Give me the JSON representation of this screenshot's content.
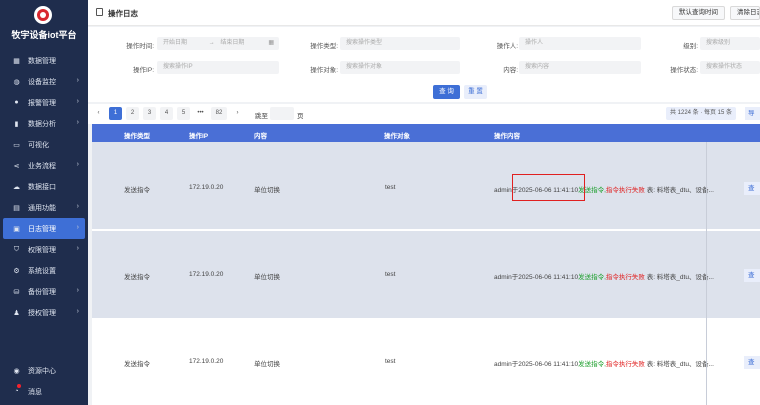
{
  "sidebar": {
    "title": "牧宇设备iot平台",
    "items": [
      {
        "label": "数据管理",
        "icon": "grid-icon",
        "arrow": false
      },
      {
        "label": "设备监控",
        "icon": "globe-icon",
        "arrow": true
      },
      {
        "label": "报警管理",
        "icon": "user-icon",
        "arrow": true
      },
      {
        "label": "数据分析",
        "icon": "bar-chart-icon",
        "arrow": true
      },
      {
        "label": "可视化",
        "icon": "monitor-icon",
        "arrow": false
      },
      {
        "label": "业务流程",
        "icon": "share-icon",
        "arrow": true
      },
      {
        "label": "数据接口",
        "icon": "cloud-icon",
        "arrow": false
      },
      {
        "label": "通用功能",
        "icon": "briefcase-icon",
        "arrow": true
      },
      {
        "label": "日志管理",
        "icon": "log-icon",
        "arrow": true,
        "active": true
      },
      {
        "label": "权限管理",
        "icon": "shield-icon",
        "arrow": true
      },
      {
        "label": "系统设置",
        "icon": "gear-icon",
        "arrow": false
      },
      {
        "label": "备份管理",
        "icon": "database-icon",
        "arrow": true
      },
      {
        "label": "授权管理",
        "icon": "key-user-icon",
        "arrow": true
      }
    ],
    "bottom": [
      {
        "label": "资源中心",
        "icon": "resource-icon"
      },
      {
        "label": "消息",
        "icon": "message-icon"
      }
    ]
  },
  "header": {
    "title": "操作日志",
    "btn_default_time": "默认查询时间",
    "btn_clear_log": "清除日志"
  },
  "filter": {
    "op_time_label": "操作时间:",
    "start_placeholder": "开始日期",
    "range_sep": "→",
    "end_placeholder": "结束日期",
    "op_type_label": "操作类型:",
    "op_type_placeholder": "搜索操作类型",
    "operator_label": "操作人:",
    "operator_placeholder": "操作人",
    "level_label": "级别:",
    "level_placeholder": "搜索级别",
    "ip_label": "操作IP:",
    "ip_placeholder": "搜索操作IP",
    "target_label": "操作对象:",
    "target_placeholder": "搜索操作对象",
    "content_label": "内容:",
    "content_placeholder": "搜索内容",
    "status_label": "操作状态:",
    "status_placeholder": "搜索操作状态",
    "query": "查 询",
    "reset": "重 置"
  },
  "pager": {
    "prev": "‹",
    "pages": [
      "1",
      "2",
      "3",
      "4",
      "5"
    ],
    "ellipsis": "•••",
    "last": "82",
    "next": "›",
    "jump_label": "跳至",
    "jump_suffix": "页",
    "total": "共 1224 条 · 每页 15 条",
    "export": "导 出"
  },
  "table": {
    "headers": [
      "操作类型",
      "操作IP",
      "内容",
      "操作对象",
      "操作内容"
    ],
    "rows": [
      {
        "type": "发送指令",
        "ip": "172.19.0.20",
        "content": "单位切换",
        "target": "test",
        "detail_prefix": "admin于2025-06-06 11:41:10",
        "detail_green": "发送指令,",
        "detail_red": "指令执行失败",
        "detail_suffix": " 表: 料塔表_dtu、设备...",
        "action": "查看"
      },
      {
        "type": "发送指令",
        "ip": "172.19.0.20",
        "content": "单位切换",
        "target": "test",
        "detail_prefix": "admin于2025-06-06 11:41:10",
        "detail_green": "发送指令,",
        "detail_red": "指令执行失败",
        "detail_suffix": " 表: 料塔表_dtu、设备...",
        "action": "查看"
      },
      {
        "type": "发送指令",
        "ip": "172.19.0.20",
        "content": "单位切换",
        "target": "test",
        "detail_prefix": "admin于2025-06-06 11:41:10",
        "detail_green": "发送指令,",
        "detail_red": "指令执行失败",
        "detail_suffix": " 表: 料塔表_dtu、设备...",
        "action": "查看"
      }
    ]
  },
  "colors": {
    "sidebar_bg": "#1f2d4d",
    "accent": "#3e6fd6",
    "header_bg": "#4a6fd6",
    "error": "#e02020",
    "success": "#1a9e2a"
  }
}
